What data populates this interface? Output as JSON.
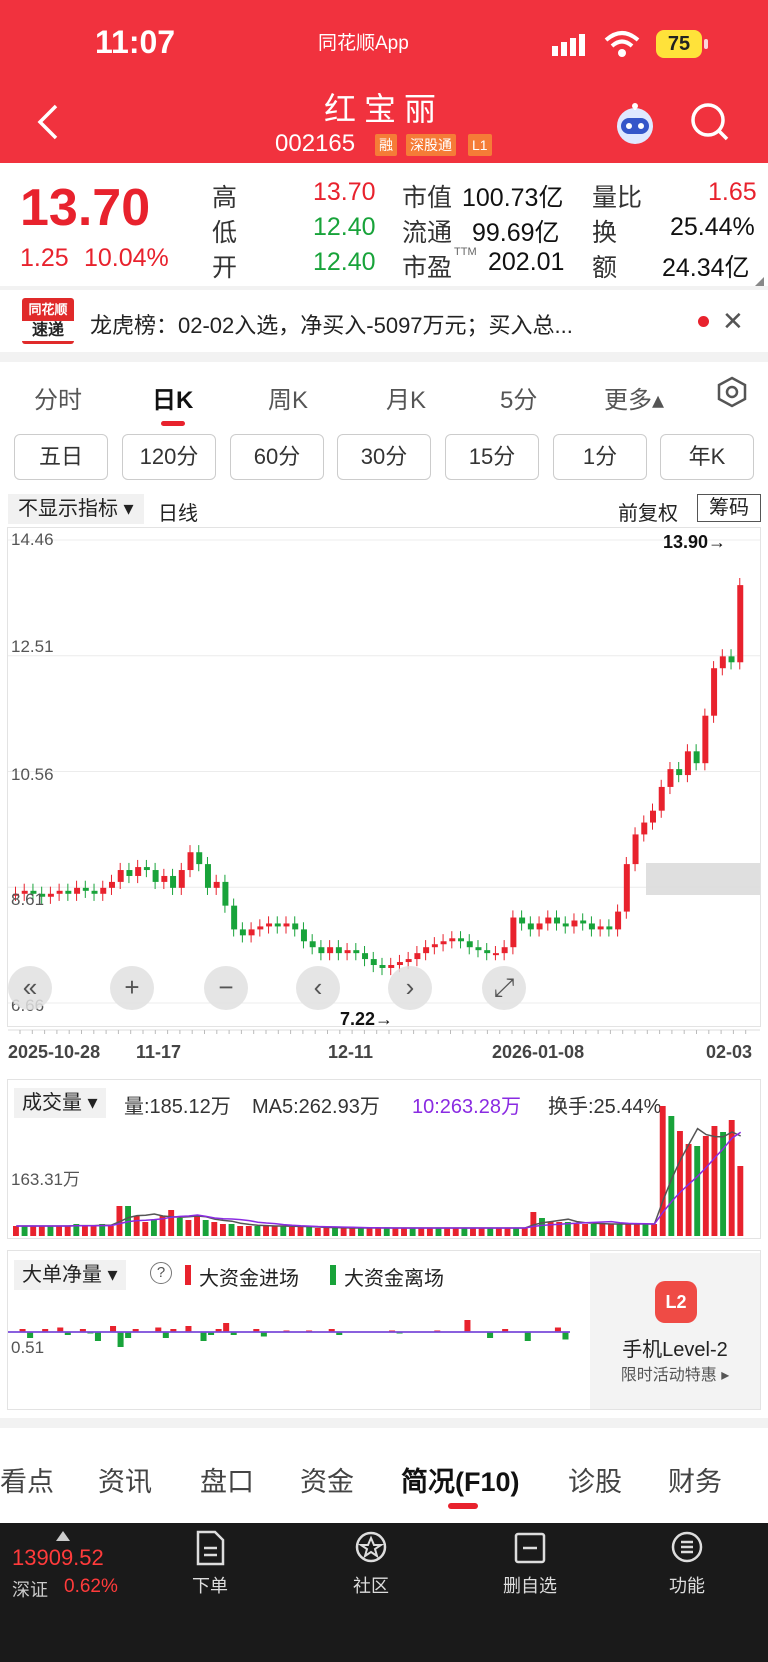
{
  "status": {
    "time": "11:07",
    "app": "同花顺App",
    "battery": "75"
  },
  "header": {
    "name": "红宝丽",
    "code": "002165",
    "tags": [
      "融",
      "深股通",
      "L1"
    ]
  },
  "quote": {
    "price": "13.70",
    "change": "1.25",
    "change_pct": "10.04%",
    "high_label": "高",
    "high": "13.70",
    "low_label": "低",
    "low": "12.40",
    "open_label": "开",
    "open": "12.40",
    "mcap_label": "市值",
    "mcap": "100.73亿",
    "float_label": "流通",
    "float": "99.69亿",
    "pe_label": "市盈",
    "pe_sup": "TTM",
    "pe": "202.01",
    "vr_label": "量比",
    "vr": "1.65",
    "turnover_label": "换",
    "turnover": "25.44%",
    "amount_label": "额",
    "amount": "24.34亿"
  },
  "news": {
    "logo_top": "同花顺",
    "logo_bottom": "速递",
    "text": "龙虎榜：02-02入选，净买入-5097万元；买入总..."
  },
  "period_tabs": [
    "分时",
    "日K",
    "周K",
    "月K",
    "5分",
    "更多▴"
  ],
  "kline_buttons": [
    "五日",
    "120分",
    "60分",
    "30分",
    "15分",
    "1分",
    "年K"
  ],
  "chart_controls": {
    "indicator": "不显示指标 ▾",
    "line_type": "日线",
    "adjust": "前复权",
    "chips": "筹码"
  },
  "chart_data": {
    "type": "candlestick",
    "y_ticks": [
      "14.46",
      "12.51",
      "10.56",
      "8.61",
      "6.66"
    ],
    "x_labels": [
      "2025-10-28",
      "11-17",
      "12-11",
      "2026-01-08",
      "02-03"
    ],
    "max_marker": "13.90→",
    "min_marker": "7.22→",
    "ylim": [
      6.66,
      14.46
    ]
  },
  "volume": {
    "selector": "成交量 ▾",
    "vol": "量:185.12万",
    "ma5": "MA5:262.93万",
    "ma10": "10:263.28万",
    "turnover": "换手:25.44%",
    "axis_label": "163.31万"
  },
  "flow": {
    "selector": "大单净量 ▾",
    "help": "?",
    "in_label": "大资金进场",
    "out_label": "大资金离场",
    "axis_label": "0.51"
  },
  "promo": {
    "icon": "L2",
    "title": "手机Level-2",
    "subtitle": "限时活动特惠 ▸"
  },
  "bottom_tabs": [
    "看点",
    "资讯",
    "盘口",
    "资金",
    "简况(F10)",
    "诊股",
    "财务"
  ],
  "dock": {
    "index_value": "13909.52",
    "index_name": "深证",
    "index_change": "0.62%",
    "items": [
      "下单",
      "社区",
      "删自选",
      "功能"
    ]
  },
  "colors": {
    "header_red": "#f1323e",
    "up": "#e8222d",
    "down": "#18a33a",
    "ma10": "#8a2be2"
  }
}
